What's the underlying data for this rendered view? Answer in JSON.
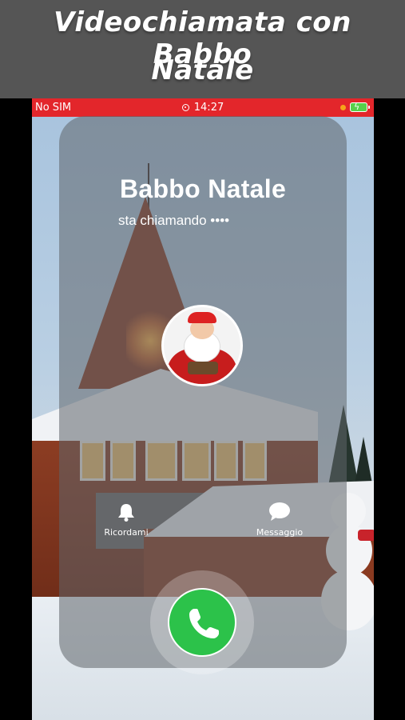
{
  "caption": {
    "line1": "Videochiamata con Babbo",
    "line2": "Natale"
  },
  "status_bar": {
    "carrier": "No SIM",
    "time": "14:27",
    "color": "#e3262b"
  },
  "call": {
    "caller_name": "Babbo Natale",
    "status_text": "sta chiamando ••••",
    "remind_label": "Ricordami",
    "message_label": "Messaggio",
    "answer_color": "#2cc24a"
  },
  "icons": [
    "record-icon",
    "battery-icon",
    "bell-icon",
    "message-bubble-icon",
    "phone-icon"
  ]
}
